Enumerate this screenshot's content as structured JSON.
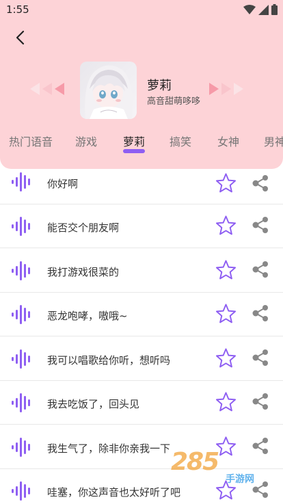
{
  "status": {
    "time": "1:55"
  },
  "voice": {
    "name": "萝莉",
    "desc": "高音甜萌哆哆"
  },
  "tabs": [
    {
      "label": "热门语音"
    },
    {
      "label": "游戏"
    },
    {
      "label": "萝莉"
    },
    {
      "label": "搞笑"
    },
    {
      "label": "女神"
    },
    {
      "label": "男神"
    }
  ],
  "active_tab": "萝莉",
  "items": [
    {
      "text": "你好啊"
    },
    {
      "text": "能否交个朋友啊"
    },
    {
      "text": "我打游戏很菜的"
    },
    {
      "text": "恶龙咆哮，嗷哦~"
    },
    {
      "text": "我可以唱歌给你听，想听吗"
    },
    {
      "text": "我去吃饭了，回头见"
    },
    {
      "text": "我生气了，除非你亲我一下"
    },
    {
      "text": "哇塞，你这声音也太好听了吧"
    }
  ],
  "watermark": {
    "main": "285",
    "sub": "手游网"
  },
  "colors": {
    "header_bg": "#fdd3d7",
    "accent": "#8e5ef2",
    "arrow": "#f7a7b3"
  }
}
